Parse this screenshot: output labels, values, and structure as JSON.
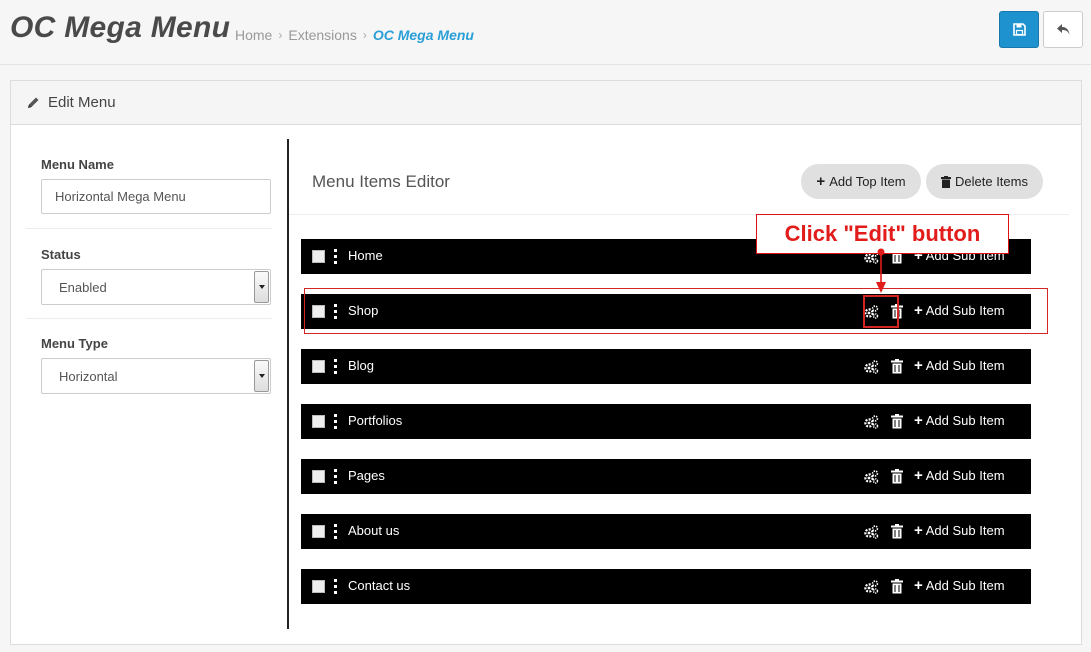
{
  "header": {
    "title": "OC Mega Menu",
    "breadcrumb": [
      {
        "label": "Home"
      },
      {
        "label": "Extensions"
      },
      {
        "label": "OC Mega Menu"
      }
    ],
    "save_icon": "floppy-disk-icon",
    "back_icon": "reply-arrow-icon"
  },
  "panel": {
    "heading": "Edit Menu",
    "heading_icon": "pencil-icon"
  },
  "form": {
    "menu_name_label": "Menu Name",
    "menu_name_value": "Horizontal Mega Menu",
    "status_label": "Status",
    "status_value": "Enabled",
    "menu_type_label": "Menu Type",
    "menu_type_value": "Horizontal"
  },
  "editor": {
    "title": "Menu Items Editor",
    "add_top_item": "Add Top Item",
    "delete_items": "Delete Items",
    "add_sub_item_label": "Add Sub Item",
    "items": [
      {
        "label": "Home"
      },
      {
        "label": "Shop"
      },
      {
        "label": "Blog"
      },
      {
        "label": "Portfolios"
      },
      {
        "label": "Pages"
      },
      {
        "label": "About us"
      },
      {
        "label": "Contact us"
      }
    ]
  },
  "annotation": {
    "callout": "Click \"Edit\" button",
    "color": "#e21b1b"
  },
  "colors": {
    "primary": "#1e91cf",
    "breadcrumb_active": "#2a9fd6",
    "row_bg": "#000000"
  }
}
